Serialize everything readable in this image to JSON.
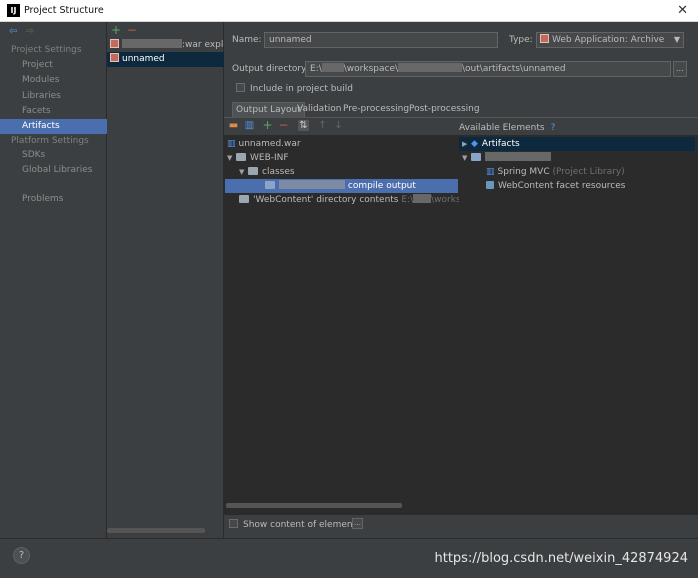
{
  "window": {
    "title": "Project Structure",
    "logo": "IJ",
    "close_glyph": "✕"
  },
  "nav": {
    "project_settings_head": "Project Settings",
    "project_items": [
      "Project",
      "Modules",
      "Libraries",
      "Facets",
      "Artifacts"
    ],
    "platform_settings_head": "Platform Settings",
    "platform_items": [
      "SDKs",
      "Global Libraries"
    ],
    "problems": "Problems",
    "selected": "Artifacts"
  },
  "artifacts_list": {
    "add_glyph": "+",
    "remove_glyph": "−",
    "items": [
      {
        "label_suffix": ":war exploded",
        "selected": false
      },
      {
        "label": "unnamed",
        "selected": true
      }
    ]
  },
  "form": {
    "name_label": "Name:",
    "name_value": "unnamed",
    "type_label": "Type:",
    "type_value": "Web Application: Archive",
    "output_dir_label": "Output directory:",
    "output_dir_prefix": "E:\\",
    "output_dir_mid": "\\workspace\\",
    "output_dir_suffix": "\\out\\artifacts\\unnamed",
    "browse_glyph": "...",
    "include_build": "Include in project build"
  },
  "tabs": [
    "Output Layout",
    "Validation",
    "Pre-processing",
    "Post-processing"
  ],
  "output_tree": {
    "root": "unnamed.war",
    "webinf": "WEB-INF",
    "classes": "classes",
    "compile_output_suffix": "compile output",
    "webcontent": "'WebContent' directory contents",
    "webcontent_path_prefix": "E:\\",
    "webcontent_path_suffix": "\\workspace"
  },
  "available": {
    "header": "Available Elements",
    "help_glyph": "?",
    "artifacts": "Artifacts",
    "spring_mvc": "Spring MVC",
    "spring_mvc_note": "(Project Library)",
    "webcontent_resources": "WebContent facet resources"
  },
  "bottom": {
    "show_content": "Show content of elements",
    "help": "?",
    "watermark": "https://blog.csdn.net/weixin_42874924"
  },
  "colors": {
    "selection": "#4b6eaf",
    "dark_panel": "#2b2b2b",
    "panel": "#3c3f41",
    "add": "#59a869",
    "remove": "#c75450"
  }
}
